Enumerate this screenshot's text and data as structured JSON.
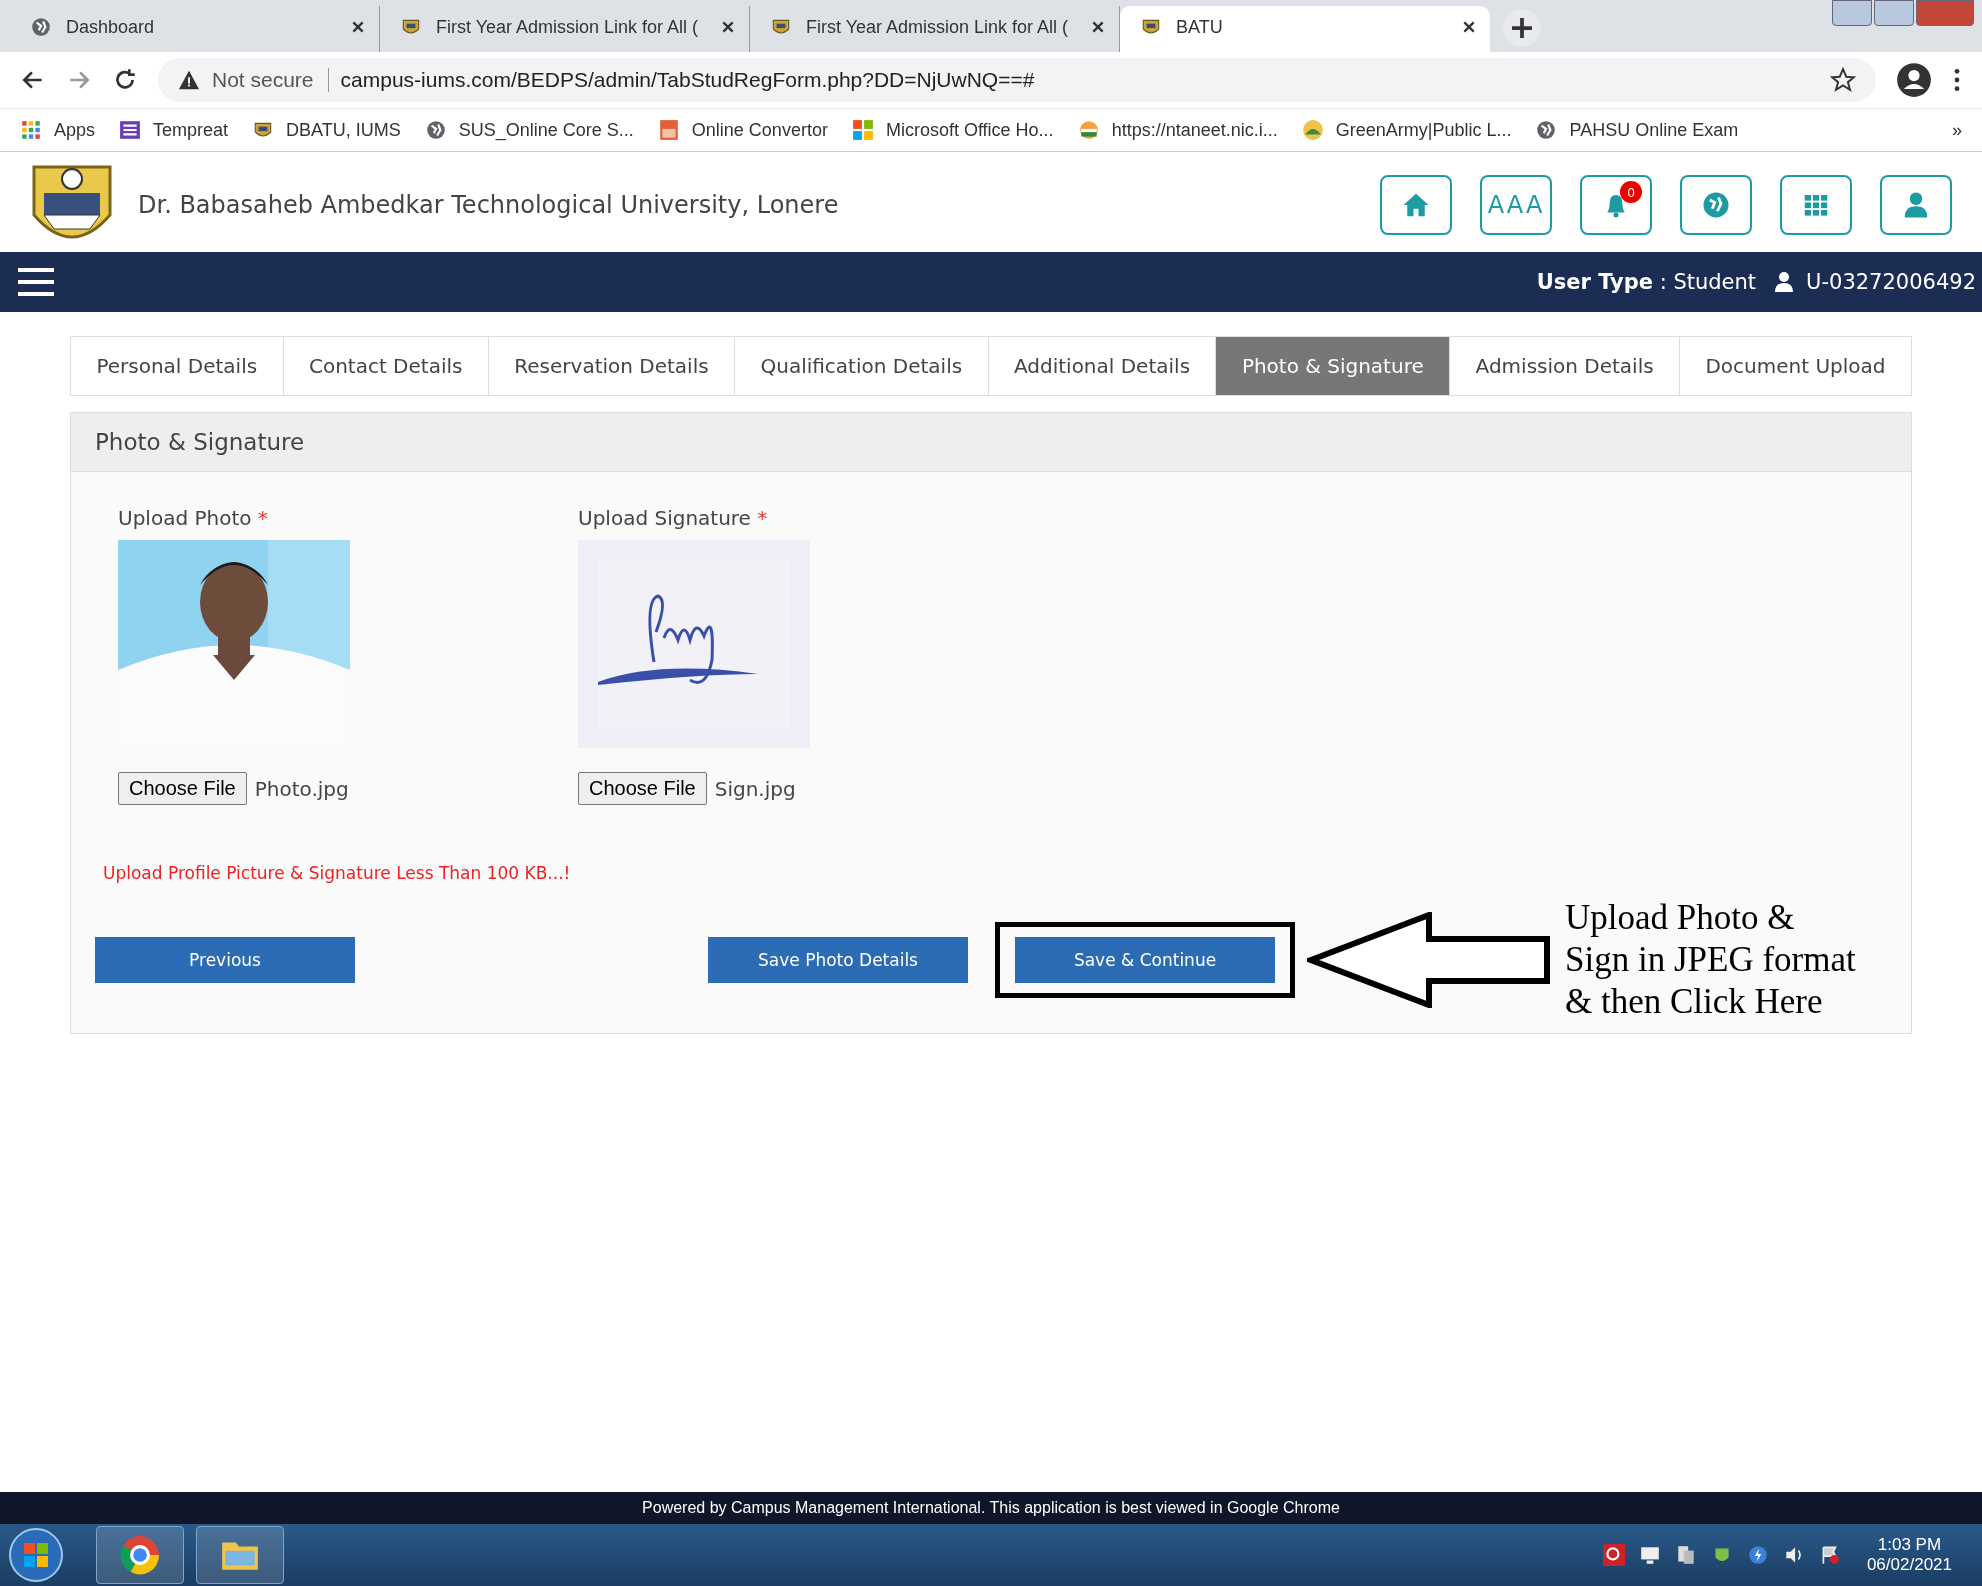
{
  "browser": {
    "tabs": [
      {
        "title": "Dashboard",
        "kind": "globe",
        "selected": false
      },
      {
        "title": "First Year Admission Link for All (",
        "kind": "logo",
        "selected": false
      },
      {
        "title": "First Year Admission Link for All (",
        "kind": "logo",
        "selected": false
      },
      {
        "title": "BATU",
        "kind": "logo",
        "selected": true
      }
    ],
    "security": "Not secure",
    "url": "campus-iums.com/BEDPS/admin/TabStudRegForm.php?DD=NjUwNQ==#",
    "bookmarks": [
      {
        "label": "Apps",
        "kind": "apps"
      },
      {
        "label": "Tempreat",
        "kind": "list"
      },
      {
        "label": "DBATU, IUMS",
        "kind": "logo"
      },
      {
        "label": "SUS_Online Core S...",
        "kind": "globe"
      },
      {
        "label": "Online Convertor",
        "kind": "jpg"
      },
      {
        "label": "Microsoft Office Ho...",
        "kind": "ms"
      },
      {
        "label": "https://ntaneet.nic.i...",
        "kind": "emblem"
      },
      {
        "label": "GreenArmy|Public L...",
        "kind": "green"
      },
      {
        "label": "PAHSU Online Exam",
        "kind": "globe"
      }
    ],
    "bookmarks_more": "»"
  },
  "header": {
    "university": "Dr. Babasaheb Ambedkar Technological University, Lonere",
    "font_size_label": "AAA",
    "notification_count": "0"
  },
  "navbar": {
    "user_type_label": "User Type",
    "user_type_value": ": Student",
    "user_id": "U-03272006492"
  },
  "form_tabs": [
    {
      "label": "Personal Details",
      "selected": false
    },
    {
      "label": "Contact Details",
      "selected": false
    },
    {
      "label": "Reservation Details",
      "selected": false
    },
    {
      "label": "Qualification Details",
      "selected": false
    },
    {
      "label": "Additional Details",
      "selected": false
    },
    {
      "label": "Photo & Signature",
      "selected": true
    },
    {
      "label": "Admission Details",
      "selected": false
    },
    {
      "label": "Document Upload",
      "selected": false
    }
  ],
  "panel": {
    "title": "Photo & Signature",
    "uploads": [
      {
        "label": "Upload Photo",
        "required": "*",
        "button": "Choose File",
        "file": "Photo.jpg"
      },
      {
        "label": "Upload Signature",
        "required": "*",
        "kind": "signature",
        "button": "Choose File",
        "file": "Sign.jpg"
      }
    ],
    "warning": "Upload Profile Picture & Signature Less Than 100 KB...!",
    "buttons": {
      "previous": "Previous",
      "save": "Save Photo Details",
      "continue": "Save & Continue"
    }
  },
  "annotation": {
    "lines": [
      "Upload Photo &",
      "Sign in JPEG format",
      "& then Click Here"
    ]
  },
  "footer": "Powered by Campus Management International. This application is best viewed in Google Chrome",
  "taskbar": {
    "time": "1:03 PM",
    "date": "06/02/2021"
  }
}
